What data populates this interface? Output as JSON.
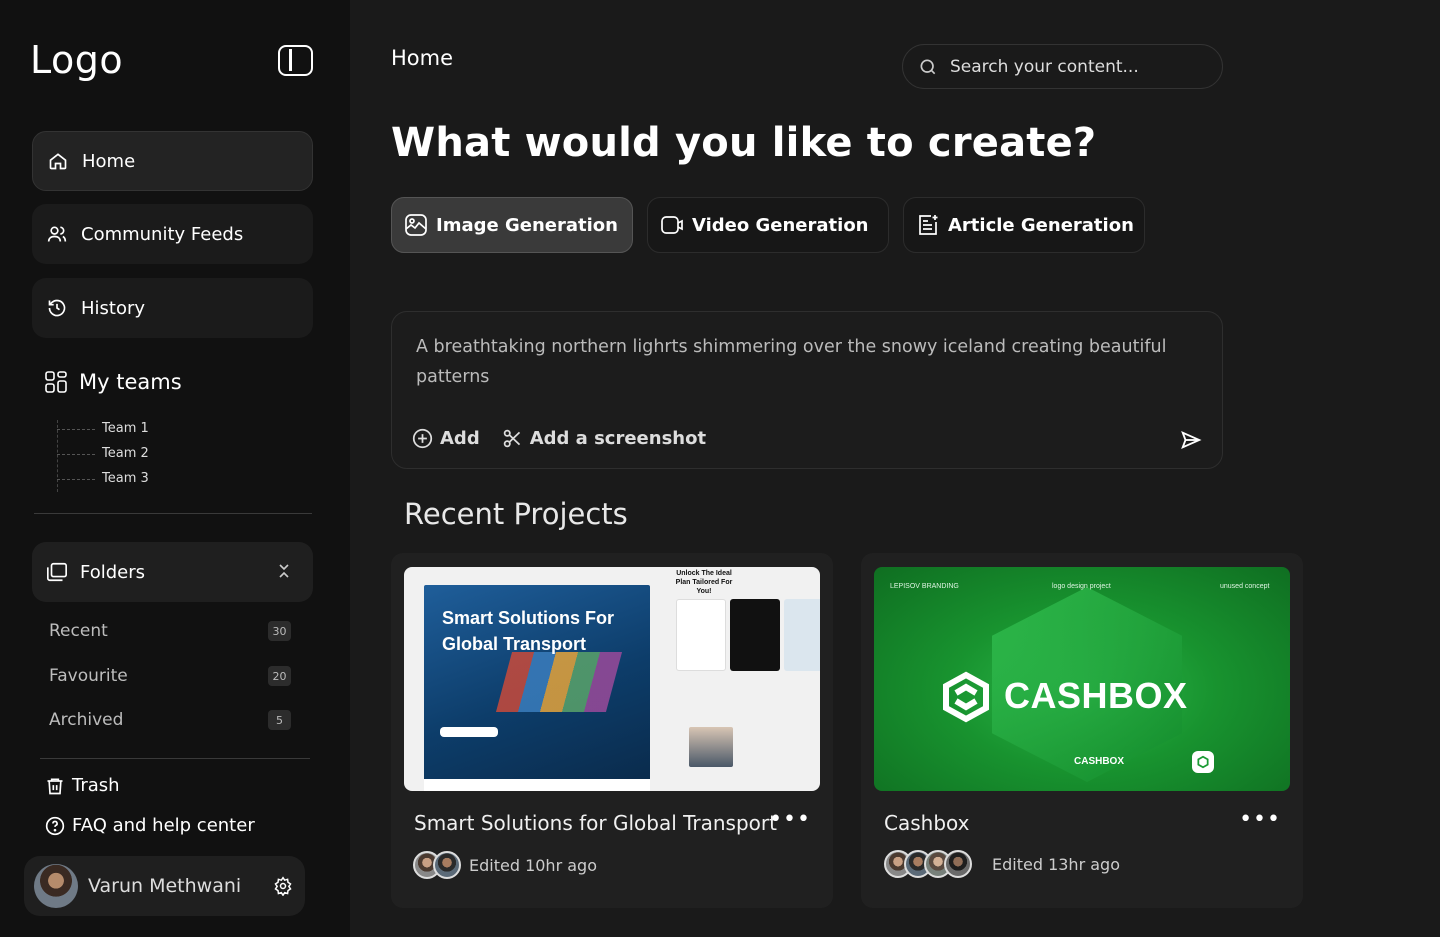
{
  "sidebar": {
    "logo": "Logo",
    "nav": [
      {
        "label": "Home",
        "icon": "home-icon"
      },
      {
        "label": "Community Feeds",
        "icon": "users-icon"
      },
      {
        "label": "History",
        "icon": "history-icon"
      }
    ],
    "teams": {
      "title": "My teams",
      "items": [
        "Team 1",
        "Team 2",
        "Team 3"
      ]
    },
    "folders": {
      "title": "Folders",
      "items": [
        {
          "label": "Recent",
          "count": "30"
        },
        {
          "label": "Favourite",
          "count": "20"
        },
        {
          "label": "Archived",
          "count": "5"
        }
      ]
    },
    "trash": "Trash",
    "faq": "FAQ and help center",
    "user": {
      "name": "Varun Methwani"
    }
  },
  "header": {
    "breadcrumb": "Home",
    "search_placeholder": "Search your content..."
  },
  "main": {
    "headline": "What would you like to create?",
    "tabs": [
      {
        "label": "Image Generation",
        "icon": "image-icon",
        "active": true
      },
      {
        "label": "Video Generation",
        "icon": "video-icon",
        "active": false
      },
      {
        "label": "Article Generation",
        "icon": "article-icon",
        "active": false
      }
    ],
    "prompt": {
      "text": "A breathtaking northern lighrts shimmering over the snowy iceland creating beautiful patterns",
      "add_label": "Add",
      "screenshot_label": "Add a screenshot"
    },
    "recent_title": "Recent Projects",
    "projects": [
      {
        "title": "Smart Solutions for Global Transport",
        "edited": "Edited 10hr ago",
        "thumb_heading_1": "Smart Solutions For",
        "thumb_heading_2": "Global Transport",
        "thumb_plan": "Unlock The Ideal Plan Tailored For You!"
      },
      {
        "title": "Cashbox",
        "edited": "Edited 13hr ago",
        "thumb_word": "CASHBOX",
        "thumb_brand": "LEPISOV BRANDING",
        "thumb_project": "logo design project",
        "thumb_concept": "unused concept",
        "thumb_small": "CASHBOX"
      }
    ]
  },
  "colors": {
    "sidebar_bg": "#111111",
    "main_bg": "#1a1a1a",
    "active_tab_bg": "#3a3a3a",
    "cashbox_green": "#1a9a33"
  }
}
